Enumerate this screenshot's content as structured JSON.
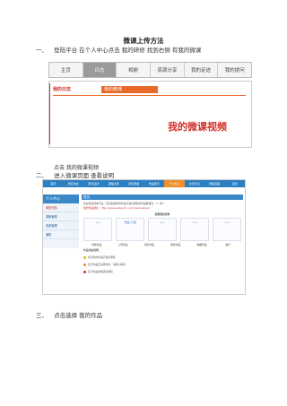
{
  "doc": {
    "title": "微课上传方法",
    "steps": [
      {
        "num": "一、",
        "text": "登陆平台 在个人中心点击 我的研修 找到右侧 有我的微课"
      },
      {
        "num": "二、",
        "text": "进入微课页面 查看说明"
      },
      {
        "num": "三、",
        "text": "点击选择 我的作品"
      }
    ],
    "caption_after_banner": "点击 我的微课视频"
  },
  "nav_tabs": [
    "主页",
    "日志",
    "相册",
    "资源分享",
    "我的足迹",
    "我的提问"
  ],
  "banner": {
    "tab_label": "我的日志",
    "tab_label_2": "我的微课",
    "big_text": "我的微课视频"
  },
  "portal": {
    "top_items": [
      "首页",
      "研究动态",
      "研究活动",
      "课程资源",
      "研究网络",
      "作品展示",
      "个人中心",
      "交流平台",
      "网络直播",
      "退出"
    ],
    "top_active": "个人中心",
    "side_head": "个人中心",
    "side_items": [
      "我的作品",
      "课程管理",
      "资源管理",
      "通知"
    ],
    "main_head": "首页",
    "intro": "欢迎您使用本平台！您目前发布的作品已通过审核的作品数量为：1（件）",
    "link": "我的作品地址：http://www.weiteach.com/class/upload",
    "table_head": "您需要的资料",
    "cells": [
      "•••",
      "作品\n介绍",
      "•••",
      "•••",
      "•••"
    ],
    "row_labels": [
      "查看作品",
      "上传作品",
      "浏览作品",
      "审核作品",
      "收藏作品",
      "统计"
    ],
    "legend_title": "作品状态说明：",
    "legend": [
      "表示您的作品已通过审核",
      "表示作品正在审核中，请耐心等待",
      "表示作品未能通过审核"
    ],
    "icon_colors": {
      "ok": "#e6b800",
      "pending": "#f08a2d",
      "fail": "#d0302a"
    }
  }
}
